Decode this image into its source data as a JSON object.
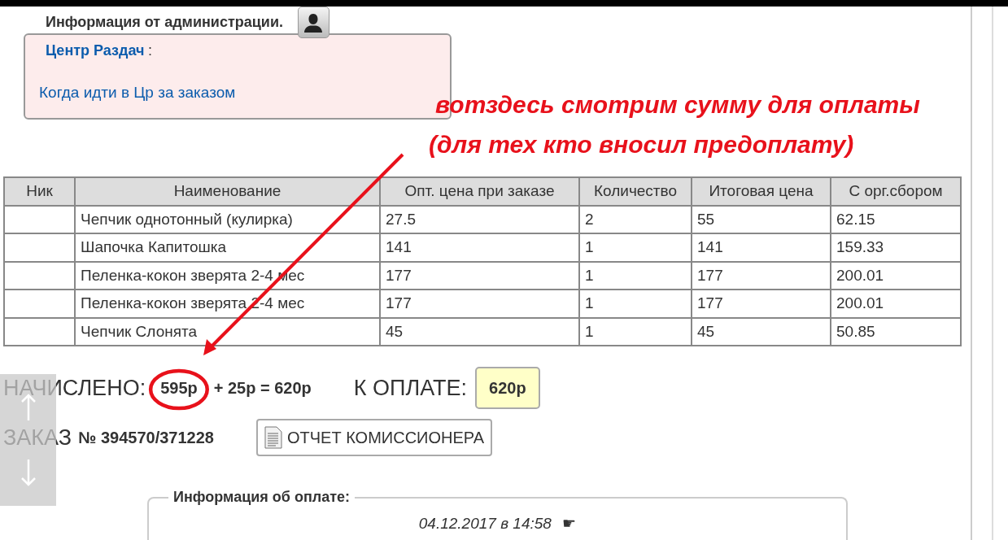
{
  "admin": {
    "title": "Информация от администрации.",
    "center": "Центр Раздач",
    "center_suffix": ":",
    "link": "Когда идти в Цр за заказом"
  },
  "annotation": {
    "lines": [
      "вотздесь смотрим сумму для оплаты",
      "(для тех кто вносил предоплату)"
    ]
  },
  "table": {
    "columns": [
      "Ник",
      "Наименование",
      "Опт. цена при заказе",
      "Количество",
      "Итоговая цена",
      "С орг.сбором"
    ],
    "rows": [
      [
        "",
        "Чепчик однотонный (кулирка)",
        "27.5",
        "2",
        "55",
        "62.15"
      ],
      [
        "",
        "Шапочка Капитошка",
        "141",
        "1",
        "141",
        "159.33"
      ],
      [
        "",
        "Пеленка-кокон зверята 2-4 мес",
        "177",
        "1",
        "177",
        "200.01"
      ],
      [
        "",
        "Пеленка-кокон зверята 2-4 мес",
        "177",
        "1",
        "177",
        "200.01"
      ],
      [
        "",
        "Чепчик Слонята",
        "45",
        "1",
        "45",
        "50.85"
      ]
    ]
  },
  "totals": {
    "accrued_label": "НАЧИСЛЕНО:",
    "accrued_value": "595р",
    "accrued_rest": "+ 25р = 620р",
    "pay_label": "К ОПЛАТЕ:",
    "pay_value": "620р"
  },
  "order": {
    "label": "ЗАКАЗ",
    "number": "№ 394570/371228",
    "report_button": "ОТЧЕТ КОМИССИОНЕРА"
  },
  "payment_info": {
    "legend": "Информация об оплате:",
    "date": "04.12.2017 в 14:58",
    "marker": "☛"
  }
}
